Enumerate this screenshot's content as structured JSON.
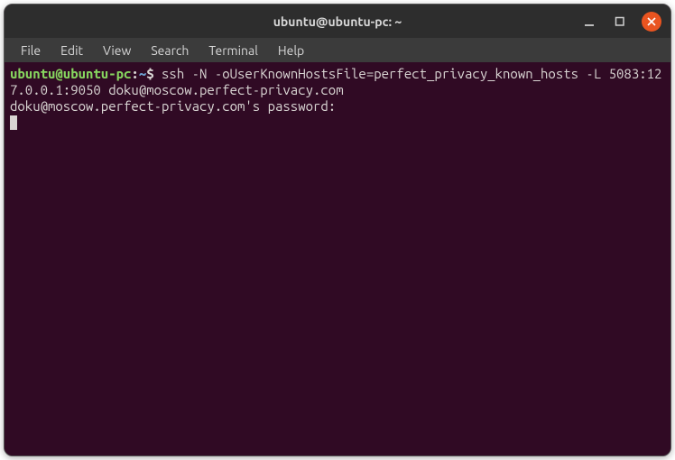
{
  "window": {
    "title": "ubuntu@ubuntu-pc: ~"
  },
  "menubar": {
    "items": [
      "File",
      "Edit",
      "View",
      "Search",
      "Terminal",
      "Help"
    ]
  },
  "terminal": {
    "prompt": {
      "user_host": "ubuntu@ubuntu-pc",
      "colon": ":",
      "path": "~",
      "dollar": "$"
    },
    "command": "ssh -N -oUserKnownHostsFile=perfect_privacy_known_hosts -L 5083:127.0.0.1:9050 doku@moscow.perfect-privacy.com",
    "output_line": "doku@moscow.perfect-privacy.com's password:"
  }
}
